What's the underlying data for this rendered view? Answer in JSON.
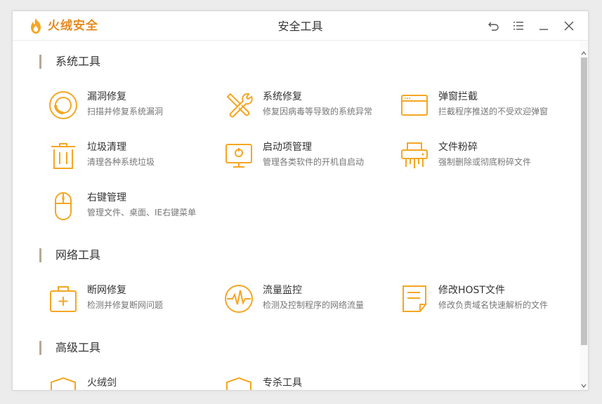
{
  "app": {
    "name": "火绒安全",
    "window_title": "安全工具",
    "accent": "#f5a623",
    "brand_color": "#e58a1f"
  },
  "titlebar_controls": [
    {
      "icon": "back-icon"
    },
    {
      "icon": "menu-icon"
    },
    {
      "icon": "minimize-icon"
    },
    {
      "icon": "close-icon"
    }
  ],
  "sections": [
    {
      "title": "系统工具",
      "tools": [
        {
          "name": "漏洞修复",
          "desc": "扫描并修复系统漏洞",
          "icon": "vulnerability-fix-icon"
        },
        {
          "name": "系统修复",
          "desc": "修复因病毒等导致的系统异常",
          "icon": "system-repair-icon"
        },
        {
          "name": "弹窗拦截",
          "desc": "拦截程序推送的不受欢迎弹窗",
          "icon": "popup-block-icon"
        },
        {
          "name": "垃圾清理",
          "desc": "清理各种系统垃圾",
          "icon": "trash-icon"
        },
        {
          "name": "启动项管理",
          "desc": "管理各类软件的开机自启动",
          "icon": "startup-icon"
        },
        {
          "name": "文件粉碎",
          "desc": "强制删除或彻底粉碎文件",
          "icon": "shredder-icon"
        },
        {
          "name": "右键管理",
          "desc": "管理文件、桌面、IE右键菜单",
          "icon": "mouse-icon"
        }
      ]
    },
    {
      "title": "网络工具",
      "tools": [
        {
          "name": "断网修复",
          "desc": "检测并修复断网问题",
          "icon": "medkit-icon"
        },
        {
          "name": "流量监控",
          "desc": "检测及控制程序的网络流量",
          "icon": "traffic-icon"
        },
        {
          "name": "修改HOST文件",
          "desc": "修改负责域名快速解析的文件",
          "icon": "document-icon"
        }
      ]
    },
    {
      "title": "高级工具",
      "tools": [
        {
          "name": "火绒剑",
          "desc": "",
          "icon": "shield-icon"
        },
        {
          "name": "专杀工具",
          "desc": "",
          "icon": "shield-icon"
        }
      ]
    }
  ]
}
